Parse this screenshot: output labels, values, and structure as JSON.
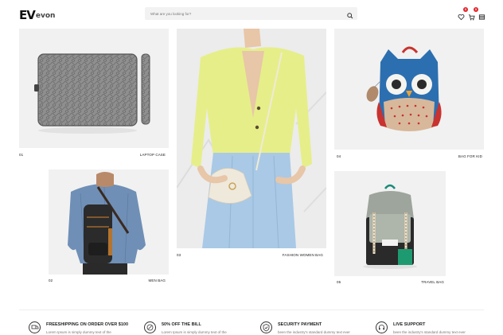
{
  "header": {
    "logo_mark": "EV",
    "logo_text": "evon",
    "search_placeholder": "What are you looking for?",
    "wishlist_count": "0",
    "cart_count": "0"
  },
  "products": [
    {
      "number": "01",
      "name": "LAPTOP CASE"
    },
    {
      "number": "02",
      "name": "MEN BAG"
    },
    {
      "number": "03",
      "name": "FASHION WOMEN BAG"
    },
    {
      "number": "04",
      "name": "BAG FOR KID"
    },
    {
      "number": "05",
      "name": "TRAVEL BAG"
    }
  ],
  "features": [
    {
      "title": "FREESHIPPING ON ORDER OVER $100",
      "desc": "Lorem Ipsum is simply dummy text of the",
      "icon": "shipping-icon"
    },
    {
      "title": "50% OFF THE BILL",
      "desc": "Lorem Ipsum is simply dummy text of the",
      "icon": "discount-icon"
    },
    {
      "title": "SECURITY PAYMENT",
      "desc": "been the industry's standard dummy text ever",
      "icon": "shield-icon"
    },
    {
      "title": "LIVE SUPPORT",
      "desc": "been the industry's standard dummy text ever",
      "icon": "headset-icon"
    }
  ],
  "colors": {
    "accent": "#e4242b",
    "panel": "#f1f1f1"
  }
}
